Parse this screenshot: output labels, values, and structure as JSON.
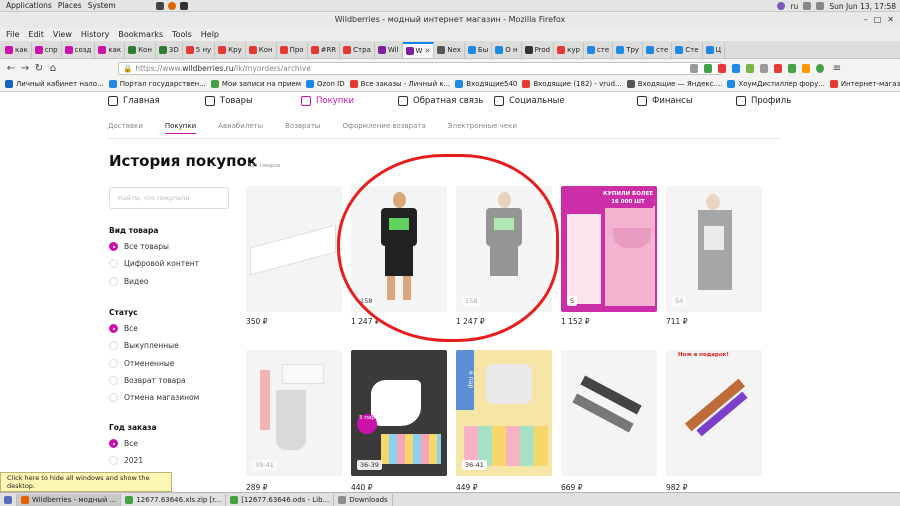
{
  "system": {
    "menu": [
      "Applications",
      "Places",
      "System"
    ],
    "clock": "Sun Jun 13, 17:58",
    "lang": "ru"
  },
  "window": {
    "title": "Wildberries - модный интернет магазин - Mozilla Firefox"
  },
  "menubar": [
    "File",
    "Edit",
    "View",
    "History",
    "Bookmarks",
    "Tools",
    "Help"
  ],
  "tabs": [
    {
      "label": "как",
      "color": "#cb11ab"
    },
    {
      "label": "спр",
      "color": "#cb11ab"
    },
    {
      "label": "созд",
      "color": "#cb11ab"
    },
    {
      "label": "как",
      "color": "#cb11ab"
    },
    {
      "label": "Кон",
      "color": "#2e7d32"
    },
    {
      "label": "3D",
      "color": "#2e7d32"
    },
    {
      "label": "5 ну",
      "color": "#e53935"
    },
    {
      "label": "Кру",
      "color": "#e53935"
    },
    {
      "label": "Кон",
      "color": "#e53935"
    },
    {
      "label": "Про",
      "color": "#e53935"
    },
    {
      "label": "#RR",
      "color": "#e53935"
    },
    {
      "label": "Стра",
      "color": "#e53935"
    },
    {
      "label": "Wil",
      "color": "#7b1fa2"
    },
    {
      "label": "W",
      "color": "#7b1fa2"
    },
    {
      "label": "Nex",
      "color": "#555555"
    },
    {
      "label": "Бы",
      "color": "#1e88e5"
    },
    {
      "label": "О н",
      "color": "#1e88e5"
    },
    {
      "label": "Prod",
      "color": "#333333"
    },
    {
      "label": "кур",
      "color": "#e53935"
    },
    {
      "label": "сте",
      "color": "#1e88e5"
    },
    {
      "label": "Тру",
      "color": "#1e88e5"
    },
    {
      "label": "сте",
      "color": "#1e88e5"
    },
    {
      "label": "Сте",
      "color": "#1e88e5"
    },
    {
      "label": "Ц",
      "color": "#1e88e5"
    }
  ],
  "url": {
    "prefix": "https://www.",
    "main": "wildberries.ru",
    "path": "/lk/myorders/archive"
  },
  "bookmarks": [
    {
      "label": "Личный кабинет нало...",
      "color": "#1565c0"
    },
    {
      "label": "Портал государствен...",
      "color": "#1e88e5"
    },
    {
      "label": "Мои записи на прием",
      "color": "#43a047"
    },
    {
      "label": "Ozon ID",
      "color": "#1e88e5"
    },
    {
      "label": "Все заказы - Личный к...",
      "color": "#e53935"
    },
    {
      "label": "Входящие540",
      "color": "#1e88e5"
    },
    {
      "label": "Входящие (182) - vrud...",
      "color": "#e53935"
    },
    {
      "label": "Входящие — Яндекс....",
      "color": "#555555"
    },
    {
      "label": "ХоумДистиллер фору...",
      "color": "#1e88e5"
    },
    {
      "label": "Интернет-магазин бы...",
      "color": "#e53935"
    }
  ],
  "nav": [
    {
      "label": "Главная",
      "active": false
    },
    {
      "label": "Товары",
      "active": false
    },
    {
      "label": "Покупки",
      "active": true
    },
    {
      "label": "Обратная связь",
      "active": false
    },
    {
      "label": "Социальные",
      "active": false
    },
    {
      "label": "Финансы",
      "active": false
    },
    {
      "label": "Профиль",
      "active": false
    }
  ],
  "subnav": [
    "Доставки",
    "Покупки",
    "Авиабилеты",
    "Возвраты",
    "Оформление возврата",
    "Электронные чеки"
  ],
  "page": {
    "title": "История покупок",
    "count": "123 товаров",
    "search_placeholder": "Найти, что покупали"
  },
  "filters": {
    "type_title": "Вид товара",
    "type_options": [
      "Все товары",
      "Цифровой контент",
      "Видео"
    ],
    "status_title": "Статус",
    "status_options": [
      "Все",
      "Выкупленные",
      "Отмененные",
      "Возврат товара",
      "Отмена магазином"
    ],
    "year_title": "Год заказа",
    "year_options": [
      "Все",
      "2021"
    ]
  },
  "products": [
    {
      "price": "350 ₽",
      "badge": ""
    },
    {
      "price": "1 247 ₽",
      "badge": "158"
    },
    {
      "price": "1 247 ₽",
      "badge": "158",
      "dim": true
    },
    {
      "price": "1 152 ₽",
      "badge": "S",
      "promo": "КУПИЛИ БОЛЕЕ 16 000 ШТ"
    },
    {
      "price": "711 ₽",
      "badge": "54",
      "dim": true
    },
    {
      "price": "289 ₽",
      "badge": "39-41",
      "dim": true
    },
    {
      "price": "440 ₽",
      "badge": "36-39",
      "promo": "5 пар"
    },
    {
      "price": "449 ₽",
      "badge": "36-41",
      "promo": "6 пар"
    },
    {
      "price": "669 ₽",
      "badge": ""
    },
    {
      "price": "982 ₽",
      "badge": "",
      "promo": "Нож в подарок!"
    }
  ],
  "tooltip": "Click here to hide all windows and show the desktop.",
  "taskbar": [
    {
      "label": "Wildberries - модный ...",
      "active": true
    },
    {
      "label": "12677.63646.xls.zip [r...",
      "active": false
    },
    {
      "label": "[12677.63646.ods - Lib...",
      "active": false
    },
    {
      "label": "Downloads",
      "active": false
    }
  ]
}
